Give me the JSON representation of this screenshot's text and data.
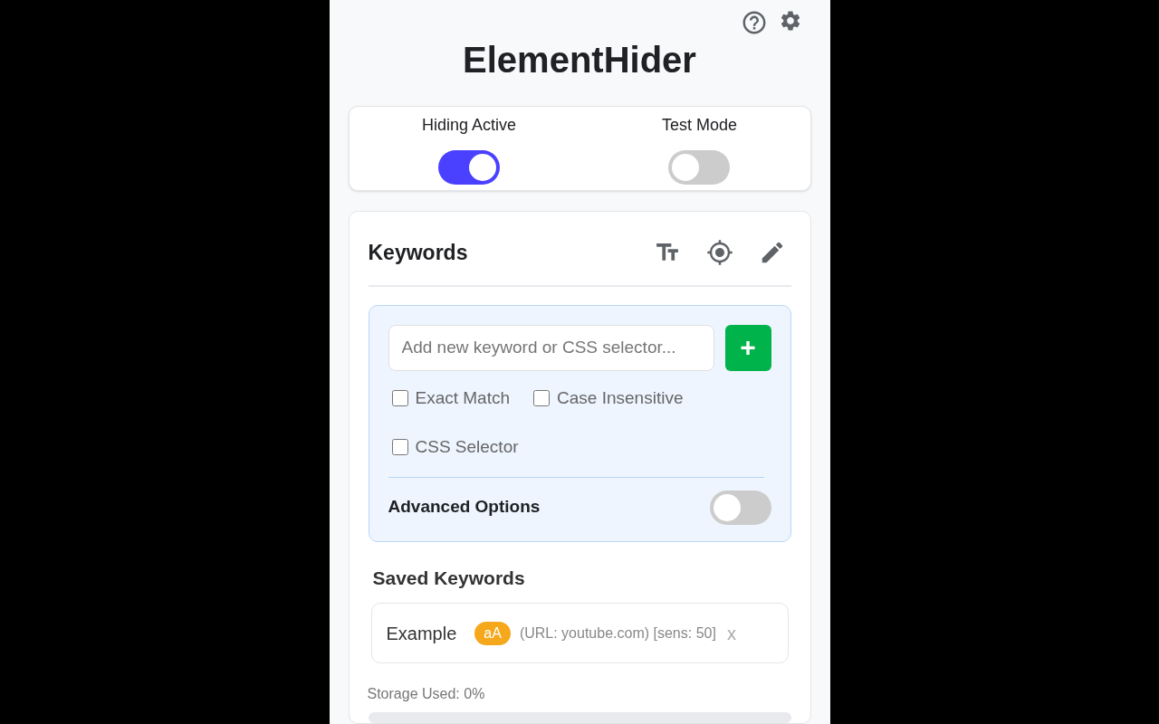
{
  "app": {
    "title": "ElementHider"
  },
  "toggles": [
    {
      "label": "Hiding Active",
      "on": true
    },
    {
      "label": "Test Mode",
      "on": false
    }
  ],
  "keywords": {
    "title": "Keywords",
    "input": {
      "placeholder": "Add new keyword or CSS selector..."
    },
    "add_button": "+",
    "options": [
      {
        "label": "Exact Match",
        "checked": false
      },
      {
        "label": "Case Insensitive",
        "checked": false
      },
      {
        "label": "CSS Selector",
        "checked": false
      }
    ],
    "advanced": {
      "label": "Advanced Options",
      "on": false
    }
  },
  "saved": {
    "title": "Saved Keywords",
    "items": [
      {
        "text": "Example",
        "badge": "aA",
        "details": "(URL: youtube.com) [sens: 50]",
        "remove": "x"
      }
    ]
  },
  "storage": {
    "label": "Storage Used: 0%",
    "level": 0
  }
}
